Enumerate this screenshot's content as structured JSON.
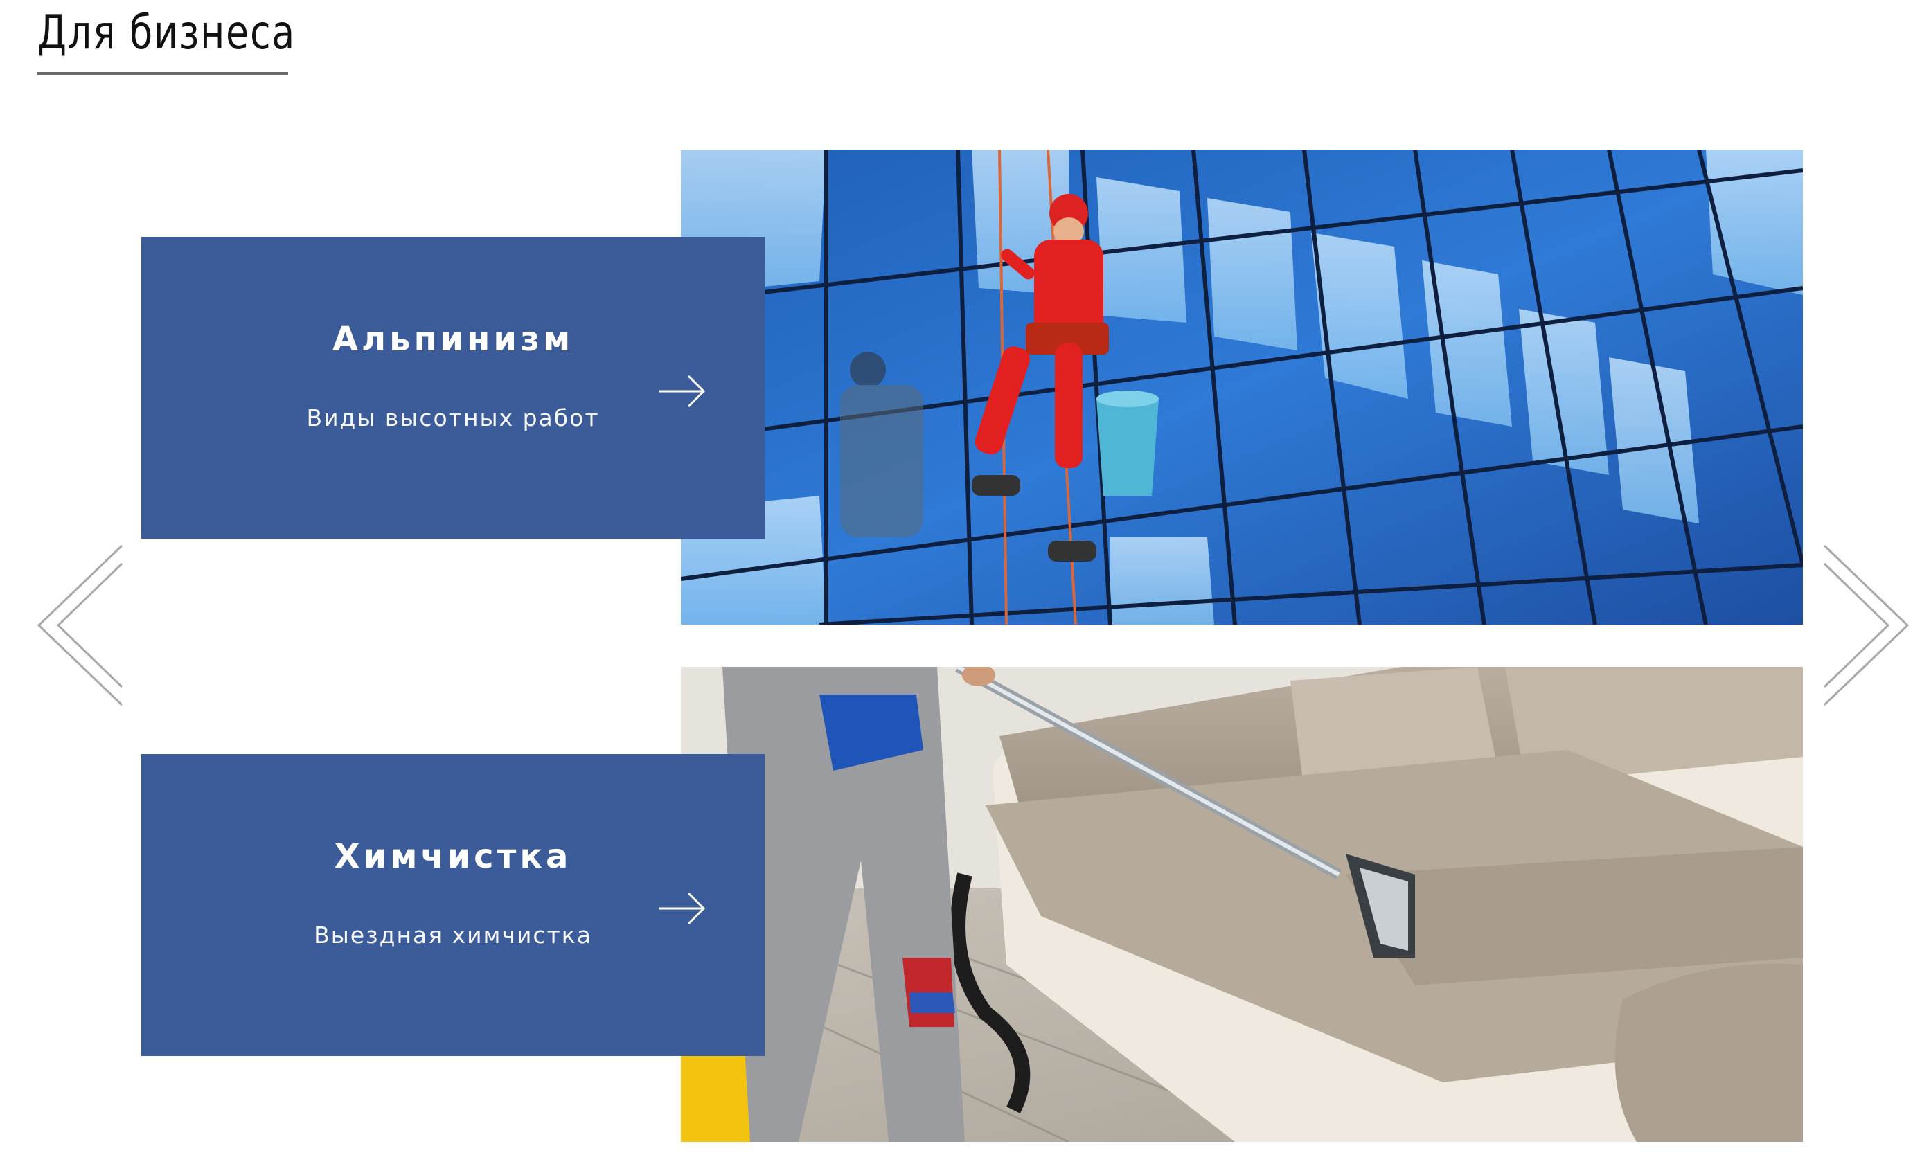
{
  "section": {
    "title": "Для бизнеса"
  },
  "carousel": {
    "prev_icon": "chevron-left-icon",
    "next_icon": "chevron-right-icon"
  },
  "cards": [
    {
      "title": "Альпинизм",
      "subtitle": "Виды высотных работ",
      "arrow_icon": "arrow-right-icon",
      "image_subject": "industrial climber cleaning glass facade"
    },
    {
      "title": "Химчистка",
      "subtitle": "Выездная химчистка",
      "arrow_icon": "arrow-right-icon",
      "image_subject": "worker vacuum-cleaning beige sofa"
    }
  ],
  "colors": {
    "panel": "#3c5b99",
    "panel_text": "#ffffff",
    "title_text": "#111111",
    "underline": "#6b6b6b",
    "nav_arrow": "#a8a8a8"
  }
}
